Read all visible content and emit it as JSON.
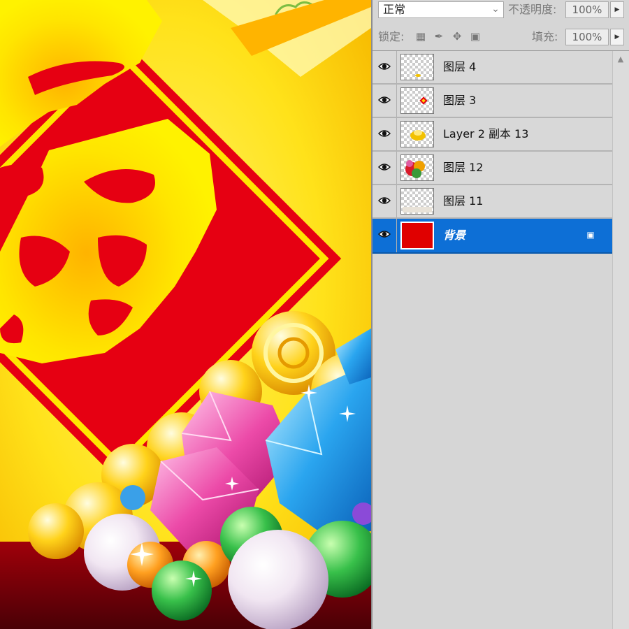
{
  "canvas": {
    "description_icons": [
      "fu-character-banner",
      "gold-ingots",
      "gemstones",
      "pearls"
    ]
  },
  "toolbar": {
    "blend_mode": "正常",
    "opacity_label": "不透明度:",
    "opacity_value": "100%",
    "lock_label": "锁定:",
    "fill_label": "填充:",
    "fill_value": "100%"
  },
  "layers": [
    {
      "name": "图层 4",
      "visible": true,
      "selected": false
    },
    {
      "name": "图层 3",
      "visible": true,
      "selected": false
    },
    {
      "name": "Layer 2 副本 13",
      "visible": true,
      "selected": false
    },
    {
      "name": "图层 12",
      "visible": true,
      "selected": false
    },
    {
      "name": "图层 11",
      "visible": true,
      "selected": false
    },
    {
      "name": "背景",
      "visible": true,
      "selected": true,
      "locked": true
    }
  ],
  "colors": {
    "selection": "#0d6fd6",
    "banner_red": "#e60012",
    "gold": "#ffd400"
  }
}
